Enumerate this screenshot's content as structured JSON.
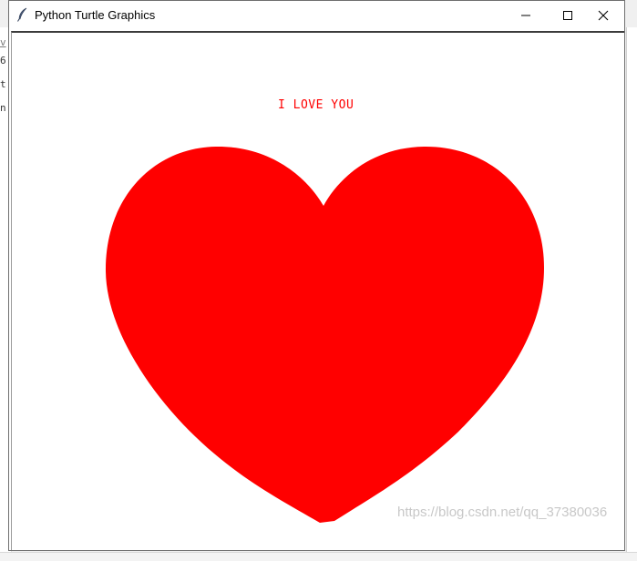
{
  "window": {
    "title": "Python Turtle Graphics",
    "icon": "feather-icon"
  },
  "controls": {
    "minimize_icon": "minimize-icon",
    "maximize_icon": "maximize-icon",
    "close_icon": "close-icon"
  },
  "canvas": {
    "text": "I LOVE YOU",
    "text_color": "#ff0000",
    "heart_color": "#ff0000",
    "background": "#ffffff"
  },
  "background_app": {
    "line_chars": [
      "v",
      "6",
      "t",
      "n"
    ]
  },
  "watermark": "https://blog.csdn.net/qq_37380036"
}
